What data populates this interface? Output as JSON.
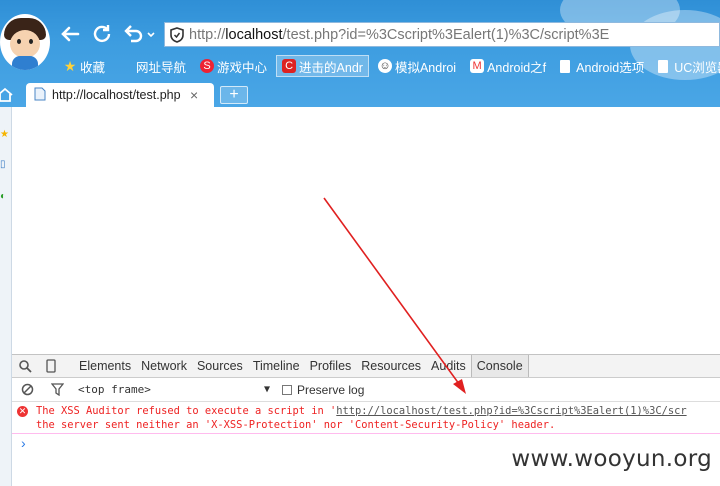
{
  "browser": {
    "address_url_prefix": "http://",
    "address_url_host": "localhost",
    "address_url_rest": "/test.php?id=%3Cscript%3Ealert(1)%3C/script%3E",
    "bookmarks": [
      {
        "label": "收藏",
        "icon": "star-icon"
      },
      {
        "label": "网址导航",
        "icon": "blank-icon"
      },
      {
        "label": "游戏中心",
        "icon": "game-icon"
      },
      {
        "label": "进击的Andr",
        "icon": "c-icon"
      },
      {
        "label": "模拟Androi",
        "icon": "android-icon"
      },
      {
        "label": "Android之f",
        "icon": "m-icon"
      },
      {
        "label": "Android选项",
        "icon": "page-icon"
      },
      {
        "label": "UC浏览器",
        "icon": "page-icon"
      }
    ],
    "tab": {
      "title": "http://localhost/test.php",
      "close": "×"
    },
    "new_tab": "+"
  },
  "devtools": {
    "tabs": [
      "Elements",
      "Network",
      "Sources",
      "Timeline",
      "Profiles",
      "Resources",
      "Audits",
      "Console"
    ],
    "selected_tab": "Console",
    "frame_select": "<top frame>",
    "preserve_log": "Preserve log",
    "console_message": {
      "line1_prefix": "The XSS Auditor refused to execute a script in '",
      "line1_link": "http://localhost/test.php?id=%3Cscript%3Ealert(1)%3C/scr",
      "line2": "the server sent neither an 'X-XSS-Protection' nor 'Content-Security-Policy' header."
    },
    "prompt": "›"
  },
  "watermark": "www.wooyun.org",
  "colors": {
    "chrome_blue": "#3d9de0",
    "error_red": "#e22222",
    "arrow_red": "#e02020"
  }
}
